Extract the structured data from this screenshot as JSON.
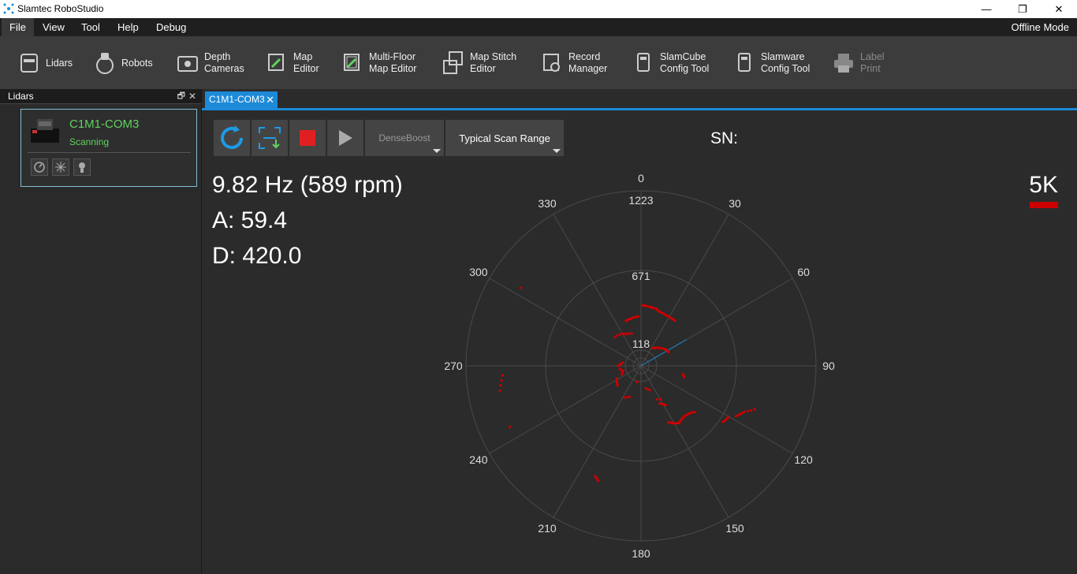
{
  "window": {
    "title": "Slamtec RoboStudio",
    "minimize": "—",
    "restore": "❐",
    "close": "✕"
  },
  "menu": {
    "items": [
      "File",
      "View",
      "Tool",
      "Help",
      "Debug"
    ],
    "mode": "Offline Mode"
  },
  "toolbar": {
    "lidars": "Lidars",
    "robots": "Robots",
    "depth_1": "Depth",
    "depth_2": "Cameras",
    "map_1": "Map",
    "map_2": "Editor",
    "mf_1": "Multi-Floor",
    "mf_2": "Map Editor",
    "stitch_1": "Map Stitch",
    "stitch_2": "Editor",
    "rec_1": "Record",
    "rec_2": "Manager",
    "cube_1": "SlamCube",
    "cube_2": "Config Tool",
    "sw_1": "Slamware",
    "sw_2": "Config Tool",
    "label_1": "Label",
    "label_2": "Print"
  },
  "panel": {
    "title": "Lidars",
    "pin": "🗗",
    "close": "✕",
    "device_name": "C1M1-COM3",
    "device_status": "Scanning"
  },
  "tab": {
    "label": "C1M1-COM3",
    "close": "✕"
  },
  "controls": {
    "denseboost": "DenseBoost",
    "scan_range": "Typical Scan Range",
    "sn": "SN:"
  },
  "metrics": {
    "freq": "9.82 Hz (589 rpm)",
    "a": "A: 59.4",
    "d": "D: 420.0",
    "rate": "5K"
  },
  "colors": {
    "accent": "#1c8ad8",
    "scan": "#cc0000",
    "status": "#5fd35f"
  },
  "chart_data": {
    "type": "scatter",
    "coordinate": "polar",
    "angle_ticks": [
      "0",
      "30",
      "60",
      "90",
      "120",
      "150",
      "180",
      "210",
      "240",
      "270",
      "300",
      "330"
    ],
    "radius_ticks": [
      "118",
      "671",
      "1223"
    ],
    "radius_max": 1223,
    "heading_deg": 60,
    "series": [
      {
        "kind": "line",
        "points": [
          [
            0,
            425
          ],
          [
            5,
            420
          ],
          [
            10,
            415
          ],
          [
            15,
            413
          ],
          [
            18,
            400
          ],
          [
            22,
            398
          ],
          [
            26,
            395
          ],
          [
            30,
            395
          ],
          [
            34,
            395
          ],
          [
            38,
            395
          ]
        ]
      },
      {
        "kind": "line",
        "points": [
          [
            31,
            140
          ],
          [
            34,
            150
          ],
          [
            38,
            160
          ],
          [
            42,
            170
          ],
          [
            46,
            180
          ],
          [
            50,
            190
          ],
          [
            54,
            200
          ],
          [
            58,
            210
          ],
          [
            62,
            215
          ],
          [
            66,
            215
          ]
        ]
      },
      {
        "kind": "line",
        "points": [
          [
            100,
            300
          ],
          [
            102,
            300
          ],
          [
            104,
            310
          ],
          [
            106,
            310
          ]
        ]
      },
      {
        "kind": "line",
        "points": [
          [
            130,
            500
          ],
          [
            133,
            480
          ],
          [
            136,
            470
          ],
          [
            139,
            465
          ],
          [
            143,
            470
          ],
          [
            146,
            480
          ],
          [
            149,
            470
          ],
          [
            152,
            450
          ],
          [
            155,
            435
          ]
        ]
      },
      {
        "kind": "line",
        "points": [
          [
            147,
            330
          ],
          [
            150,
            310
          ],
          [
            152,
            300
          ],
          [
            155,
            290
          ]
        ]
      },
      {
        "kind": "line",
        "points": [
          [
            120,
            710
          ],
          [
            123,
            700
          ],
          [
            125,
            690
          ]
        ]
      },
      {
        "kind": "dots",
        "points": [
          [
            111,
            850
          ],
          [
            112,
            830
          ],
          [
            113,
            810
          ],
          [
            114,
            790
          ],
          [
            115,
            780
          ],
          [
            116,
            770
          ],
          [
            117,
            760
          ],
          [
            118,
            750
          ]
        ]
      },
      {
        "kind": "line",
        "points": [
          [
            340,
            330
          ],
          [
            345,
            335
          ],
          [
            350,
            340
          ],
          [
            355,
            345
          ],
          [
            358,
            345
          ]
        ]
      },
      {
        "kind": "dots",
        "points": [
          [
            318,
            270
          ],
          [
            322,
            270
          ],
          [
            326,
            265
          ],
          [
            330,
            260
          ],
          [
            333,
            250
          ],
          [
            336,
            245
          ],
          [
            340,
            240
          ],
          [
            344,
            235
          ]
        ]
      },
      {
        "kind": "line",
        "points": [
          [
            228,
            215
          ],
          [
            232,
            210
          ],
          [
            236,
            205
          ],
          [
            240,
            195
          ],
          [
            244,
            185
          ]
        ]
      },
      {
        "kind": "dots",
        "points": [
          [
            270,
            160
          ],
          [
            273,
            150
          ],
          [
            276,
            140
          ],
          [
            280,
            130
          ],
          [
            262,
            150
          ],
          [
            258,
            140
          ],
          [
            254,
            130
          ],
          [
            250,
            140
          ],
          [
            246,
            145
          ]
        ]
      },
      {
        "kind": "line",
        "points": [
          [
            190,
            120
          ],
          [
            193,
            115
          ],
          [
            196,
            115
          ],
          [
            199,
            115
          ]
        ]
      },
      {
        "kind": "dots",
        "points": [
          [
            168,
            160
          ],
          [
            164,
            170
          ],
          [
            160,
            180
          ],
          [
            200,
            230
          ],
          [
            204,
            240
          ],
          [
            208,
            250
          ],
          [
            154,
            260
          ],
          [
            150,
            270
          ]
        ]
      },
      {
        "kind": "dots",
        "points": [
          [
            260,
            1000
          ],
          [
            262,
            990
          ],
          [
            264,
            980
          ],
          [
            266,
            970
          ],
          [
            245,
            1010
          ],
          [
            303,
            1000
          ]
        ]
      },
      {
        "kind": "line",
        "points": [
          [
            200,
            860
          ],
          [
            201,
            850
          ],
          [
            202,
            840
          ],
          [
            203,
            830
          ]
        ]
      }
    ]
  }
}
